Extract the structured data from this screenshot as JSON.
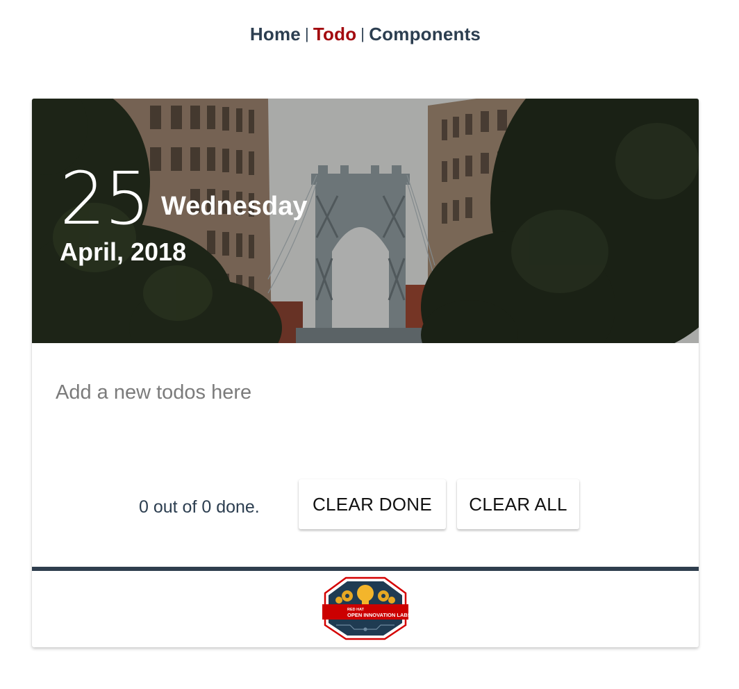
{
  "nav": {
    "items": [
      {
        "label": "Home",
        "active": false
      },
      {
        "label": "Todo",
        "active": true
      },
      {
        "label": "Components",
        "active": false
      }
    ],
    "separator": "|",
    "active_color": "#a30a0f"
  },
  "hero": {
    "day_number": "25",
    "weekday": "Wednesday",
    "month_year": "April, 2018",
    "image": "city-street-bridge-photo"
  },
  "todo": {
    "input_value": "",
    "input_placeholder": "Add a new todos here",
    "summary": "0 out of 0 done.",
    "clear_done_label": "CLEAR DONE",
    "clear_all_label": "CLEAR ALL"
  },
  "footer": {
    "logo_line1": "RED HAT",
    "logo_line2": "OPEN INNOVATION LABS",
    "logo_icon": "lightbulb-gears-logo"
  },
  "colors": {
    "nav_text": "#2c3e50",
    "divider": "#2f3e4e",
    "brand_red": "#cc0000"
  }
}
